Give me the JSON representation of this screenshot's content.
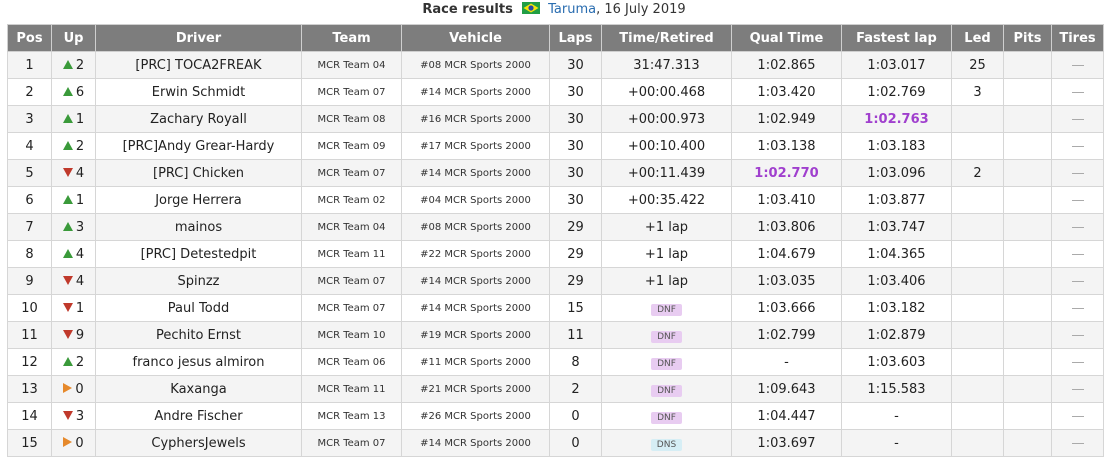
{
  "caption": {
    "title": "Race results",
    "track": "Taruma",
    "date": ", 16 July 2019"
  },
  "headers": [
    "Pos",
    "Up",
    "Driver",
    "Team",
    "Vehicle",
    "Laps",
    "Time/Retired",
    "Qual Time",
    "Fastest lap",
    "Led",
    "Pits",
    "Tires"
  ],
  "rows": [
    {
      "pos": "1",
      "dir": "up",
      "up": "2",
      "driver": "[PRC] TOCA2FREAK",
      "team": "MCR Team 04",
      "vehicle": "#08 MCR Sports 2000",
      "laps": "30",
      "time": "31:47.313",
      "status": "",
      "qual": "1:02.865",
      "qual_best": false,
      "fast": "1:03.017",
      "fast_best": false,
      "led": "25",
      "pits": ""
    },
    {
      "pos": "2",
      "dir": "up",
      "up": "6",
      "driver": "Erwin Schmidt",
      "team": "MCR Team 07",
      "vehicle": "#14 MCR Sports 2000",
      "laps": "30",
      "time": "+00:00.468",
      "status": "",
      "qual": "1:03.420",
      "qual_best": false,
      "fast": "1:02.769",
      "fast_best": false,
      "led": "3",
      "pits": ""
    },
    {
      "pos": "3",
      "dir": "up",
      "up": "1",
      "driver": "Zachary Royall",
      "team": "MCR Team 08",
      "vehicle": "#16 MCR Sports 2000",
      "laps": "30",
      "time": "+00:00.973",
      "status": "",
      "qual": "1:02.949",
      "qual_best": false,
      "fast": "1:02.763",
      "fast_best": true,
      "led": "",
      "pits": ""
    },
    {
      "pos": "4",
      "dir": "up",
      "up": "2",
      "driver": "[PRC]Andy Grear-Hardy",
      "team": "MCR Team 09",
      "vehicle": "#17 MCR Sports 2000",
      "laps": "30",
      "time": "+00:10.400",
      "status": "",
      "qual": "1:03.138",
      "qual_best": false,
      "fast": "1:03.183",
      "fast_best": false,
      "led": "",
      "pits": ""
    },
    {
      "pos": "5",
      "dir": "down",
      "up": "4",
      "driver": "[PRC] Chicken",
      "team": "MCR Team 07",
      "vehicle": "#14 MCR Sports 2000",
      "laps": "30",
      "time": "+00:11.439",
      "status": "",
      "qual": "1:02.770",
      "qual_best": true,
      "fast": "1:03.096",
      "fast_best": false,
      "led": "2",
      "pits": ""
    },
    {
      "pos": "6",
      "dir": "up",
      "up": "1",
      "driver": "Jorge Herrera",
      "team": "MCR Team 02",
      "vehicle": "#04 MCR Sports 2000",
      "laps": "30",
      "time": "+00:35.422",
      "status": "",
      "qual": "1:03.410",
      "qual_best": false,
      "fast": "1:03.877",
      "fast_best": false,
      "led": "",
      "pits": ""
    },
    {
      "pos": "7",
      "dir": "up",
      "up": "3",
      "driver": "mainos",
      "team": "MCR Team 04",
      "vehicle": "#08 MCR Sports 2000",
      "laps": "29",
      "time": "+1 lap",
      "status": "",
      "qual": "1:03.806",
      "qual_best": false,
      "fast": "1:03.747",
      "fast_best": false,
      "led": "",
      "pits": ""
    },
    {
      "pos": "8",
      "dir": "up",
      "up": "4",
      "driver": "[PRC] Detestedpit",
      "team": "MCR Team 11",
      "vehicle": "#22 MCR Sports 2000",
      "laps": "29",
      "time": "+1 lap",
      "status": "",
      "qual": "1:04.679",
      "qual_best": false,
      "fast": "1:04.365",
      "fast_best": false,
      "led": "",
      "pits": ""
    },
    {
      "pos": "9",
      "dir": "down",
      "up": "4",
      "driver": "Spinzz",
      "team": "MCR Team 07",
      "vehicle": "#14 MCR Sports 2000",
      "laps": "29",
      "time": "+1 lap",
      "status": "",
      "qual": "1:03.035",
      "qual_best": false,
      "fast": "1:03.406",
      "fast_best": false,
      "led": "",
      "pits": ""
    },
    {
      "pos": "10",
      "dir": "down",
      "up": "1",
      "driver": "Paul Todd",
      "team": "MCR Team 07",
      "vehicle": "#14 MCR Sports 2000",
      "laps": "15",
      "time": "",
      "status": "DNF",
      "qual": "1:03.666",
      "qual_best": false,
      "fast": "1:03.182",
      "fast_best": false,
      "led": "",
      "pits": ""
    },
    {
      "pos": "11",
      "dir": "down",
      "up": "9",
      "driver": "Pechito Ernst",
      "team": "MCR Team 10",
      "vehicle": "#19 MCR Sports 2000",
      "laps": "11",
      "time": "",
      "status": "DNF",
      "qual": "1:02.799",
      "qual_best": false,
      "fast": "1:02.879",
      "fast_best": false,
      "led": "",
      "pits": ""
    },
    {
      "pos": "12",
      "dir": "up",
      "up": "2",
      "driver": "franco jesus almiron",
      "team": "MCR Team 06",
      "vehicle": "#11 MCR Sports 2000",
      "laps": "8",
      "time": "",
      "status": "DNF",
      "qual": "-",
      "qual_best": false,
      "fast": "1:03.603",
      "fast_best": false,
      "led": "",
      "pits": ""
    },
    {
      "pos": "13",
      "dir": "flat",
      "up": "0",
      "driver": "Kaxanga",
      "team": "MCR Team 11",
      "vehicle": "#21 MCR Sports 2000",
      "laps": "2",
      "time": "",
      "status": "DNF",
      "qual": "1:09.643",
      "qual_best": false,
      "fast": "1:15.583",
      "fast_best": false,
      "led": "",
      "pits": ""
    },
    {
      "pos": "14",
      "dir": "down",
      "up": "3",
      "driver": "Andre Fischer",
      "team": "MCR Team 13",
      "vehicle": "#26 MCR Sports 2000",
      "laps": "0",
      "time": "",
      "status": "DNF",
      "qual": "1:04.447",
      "qual_best": false,
      "fast": "-",
      "fast_best": false,
      "led": "",
      "pits": ""
    },
    {
      "pos": "15",
      "dir": "flat",
      "up": "0",
      "driver": "CyphersJewels",
      "team": "MCR Team 07",
      "vehicle": "#14 MCR Sports 2000",
      "laps": "0",
      "time": "",
      "status": "DNS",
      "qual": "1:03.697",
      "qual_best": false,
      "fast": "-",
      "fast_best": false,
      "led": "",
      "pits": ""
    }
  ],
  "colors": {
    "up": "#3a9a3a",
    "down": "#c0392b",
    "flat": "#e6892b",
    "best": "#a03fce",
    "header_bg": "#7d7d7d"
  }
}
